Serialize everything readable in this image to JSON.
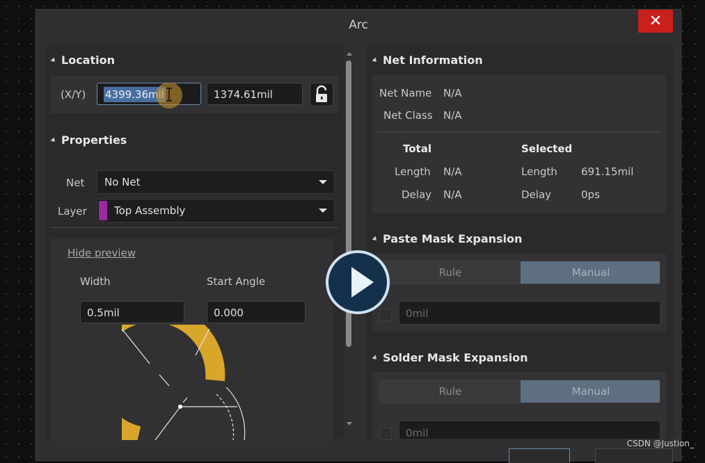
{
  "window": {
    "title": "Arc",
    "close_label": "✕"
  },
  "location": {
    "section_title": "Location",
    "xy_label": "(X/Y)",
    "x_value": "4399.36mil",
    "y_value": "1374.61mil",
    "lock_icon": "unlock-icon"
  },
  "properties": {
    "section_title": "Properties",
    "net_label": "Net",
    "net_value": "No Net",
    "layer_label": "Layer",
    "layer_value": "Top Assembly",
    "layer_color": "#9b2aa0",
    "hide_preview": "Hide preview",
    "width_label": "Width",
    "width_value": "0.5mil",
    "start_angle_label": "Start Angle",
    "start_angle_value": "0.000"
  },
  "net_info": {
    "section_title": "Net Information",
    "net_name_label": "Net Name",
    "net_name_value": "N/A",
    "net_class_label": "Net Class",
    "net_class_value": "N/A",
    "total_header": "Total",
    "selected_header": "Selected",
    "total_length_label": "Length",
    "total_length_value": "N/A",
    "total_delay_label": "Delay",
    "total_delay_value": "N/A",
    "sel_length_label": "Length",
    "sel_length_value": "691.15mil",
    "sel_delay_label": "Delay",
    "sel_delay_value": "0ps"
  },
  "paste_mask": {
    "section_title": "Paste Mask Expansion",
    "rule_label": "Rule",
    "manual_label": "Manual",
    "value": "0mil"
  },
  "solder_mask": {
    "section_title": "Solder Mask Expansion",
    "rule_label": "Rule",
    "manual_label": "Manual",
    "value": "0mil"
  },
  "watermark": "CSDN @Justion_"
}
